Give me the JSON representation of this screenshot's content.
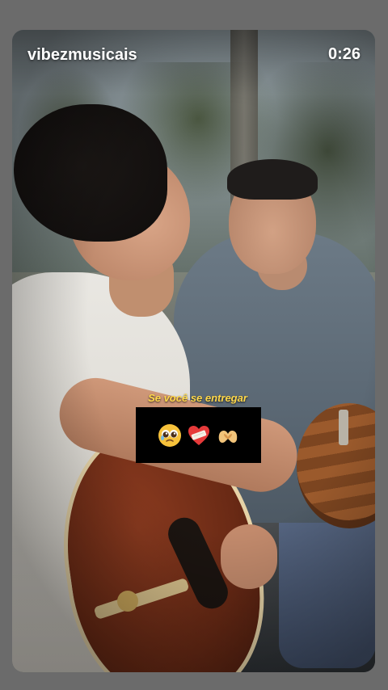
{
  "video": {
    "username": "vibezmusicais",
    "elapsed_time": "0:26"
  },
  "caption": {
    "lyric_text": "Se você se entregar",
    "emojis": [
      "pleading-face-icon",
      "mending-heart-icon",
      "heart-hands-icon"
    ]
  },
  "colors": {
    "lyric_text": "#ffd84a",
    "emoji_box_background": "#000000",
    "page_background": "#6b6b6b"
  }
}
